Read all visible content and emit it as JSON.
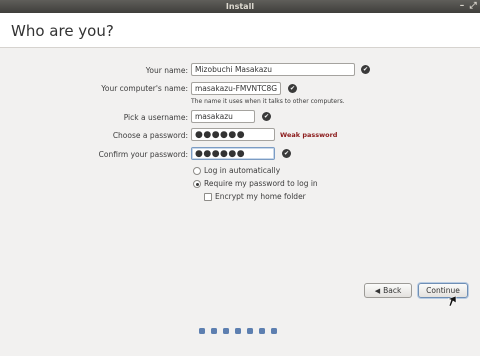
{
  "window": {
    "title": "Install"
  },
  "header": {
    "title": "Who are you?"
  },
  "form": {
    "name": {
      "label": "Your name:",
      "value": "Mizobuchi Masakazu"
    },
    "computer": {
      "label": "Your computer's name:",
      "value": "masakazu-FMVNTC8GB",
      "hint": "The name it uses when it talks to other computers."
    },
    "username": {
      "label": "Pick a username:",
      "value": "masakazu"
    },
    "password": {
      "label": "Choose a password:",
      "value": "●●●●●●",
      "strength": "Weak password"
    },
    "confirm": {
      "label": "Confirm your password:",
      "value": "●●●●●●"
    },
    "login_auto": {
      "label": "Log in automatically",
      "selected": false
    },
    "login_password": {
      "label": "Require my password to log in",
      "selected": true
    },
    "encrypt": {
      "label": "Encrypt my home folder",
      "checked": false
    }
  },
  "buttons": {
    "back": "Back",
    "continue": "Continue"
  },
  "progress": {
    "total_steps": 7
  },
  "icons": {
    "valid": "checkmark-icon",
    "back": "arrow-left-icon"
  },
  "colors": {
    "accent": "#5d7fb0",
    "weak": "#8b1a1a"
  }
}
